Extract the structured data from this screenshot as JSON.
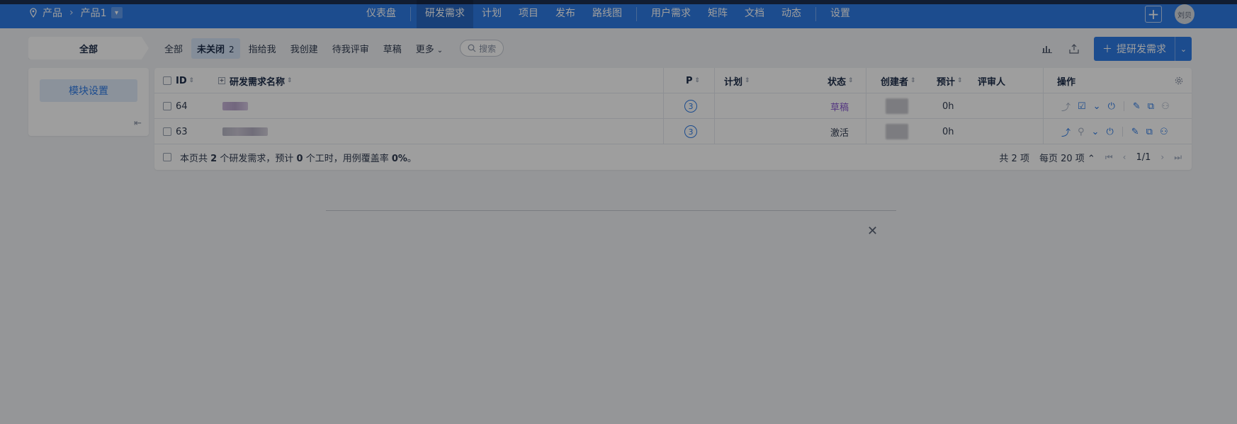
{
  "nav": {
    "breadcrumb_root": "产品",
    "breadcrumb_product": "产品1",
    "items": [
      {
        "label": "仪表盘",
        "active": false
      },
      {
        "label": "研发需求",
        "active": true
      },
      {
        "label": "计划",
        "active": false
      },
      {
        "label": "项目",
        "active": false
      },
      {
        "label": "发布",
        "active": false
      },
      {
        "label": "路线图",
        "active": false
      },
      {
        "label": "用户需求",
        "active": false
      },
      {
        "label": "矩阵",
        "active": false
      },
      {
        "label": "文档",
        "active": false
      },
      {
        "label": "动态",
        "active": false
      },
      {
        "label": "设置",
        "active": false
      }
    ],
    "avatar_text": "刘贝",
    "accent_color": "#2e7be6"
  },
  "toolbar": {
    "all_tab": "全部",
    "filters": [
      {
        "label": "全部"
      },
      {
        "label": "未关闭",
        "count": "2",
        "active": true
      },
      {
        "label": "指给我"
      },
      {
        "label": "我创建"
      },
      {
        "label": "待我评审"
      },
      {
        "label": "草稿"
      },
      {
        "label": "更多"
      }
    ],
    "search_label": "搜索",
    "create_label": "提研发需求"
  },
  "sidebar": {
    "module_settings": "模块设置"
  },
  "table": {
    "headers": {
      "id": "ID",
      "name": "研发需求名称",
      "pri": "P",
      "plan": "计划",
      "status": "状态",
      "creator": "创建者",
      "estimate": "预计",
      "reviewer": "评审人",
      "actions": "操作"
    },
    "rows": [
      {
        "id": "64",
        "pri": "3",
        "plan": "",
        "status": "草稿",
        "estimate": "0h",
        "reviewer": ""
      },
      {
        "id": "63",
        "pri": "3",
        "plan": "",
        "status": "激活",
        "estimate": "0h",
        "reviewer": ""
      }
    ],
    "summary_prefix": "本页共",
    "summary_count": "2",
    "summary_mid": "个研发需求，预计",
    "summary_hours": "0",
    "summary_suffix": "个工时，用例覆盖率",
    "summary_coverage": "0%",
    "summary_end": "。"
  },
  "pager": {
    "total": "共 2 项",
    "per_page": "每页 20 项",
    "page": "1/1"
  }
}
